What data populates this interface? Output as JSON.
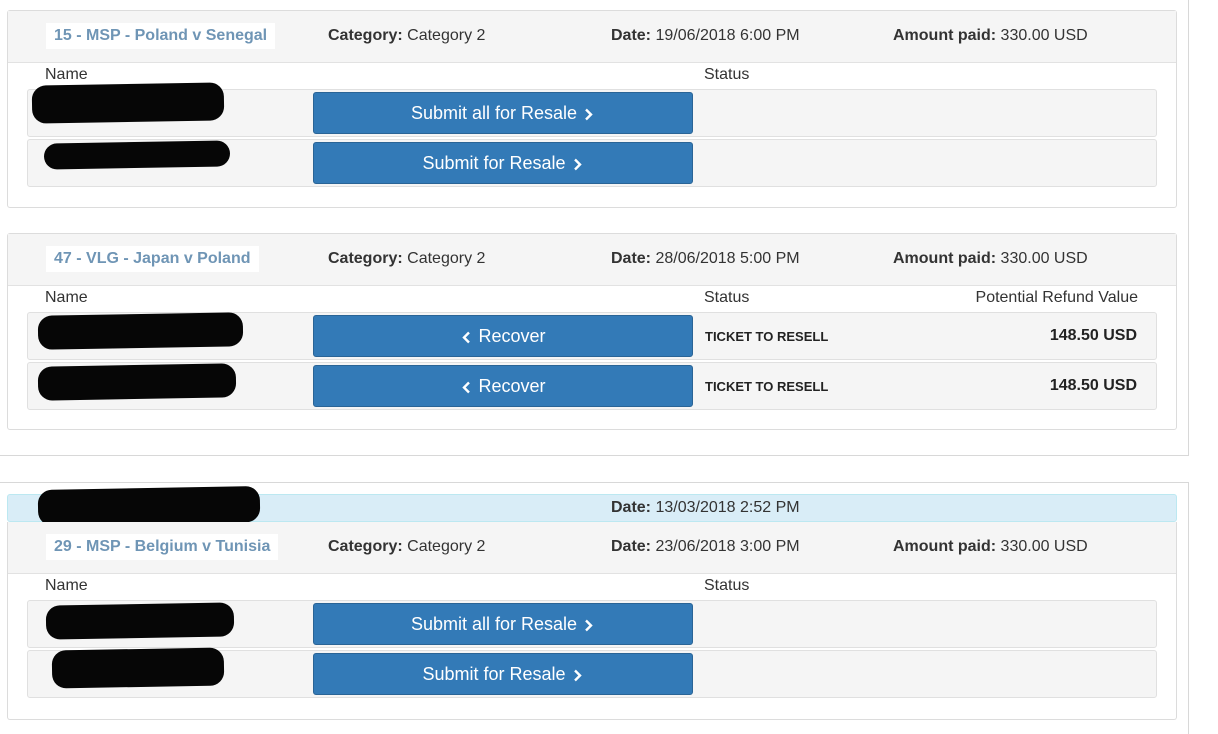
{
  "orders": [
    {
      "matches": [
        {
          "title": "15 - MSP - Poland v Senegal",
          "category_label": "Category:",
          "category_value": "Category 2",
          "date_label": "Date:",
          "date_value": "19/06/2018 6:00 PM",
          "amount_label": "Amount paid:",
          "amount_value": "330.00 USD",
          "col_name": "Name",
          "col_status": "Status",
          "tickets": [
            {
              "button": "Submit all for Resale"
            },
            {
              "button": "Submit for Resale"
            }
          ]
        },
        {
          "title": "47 - VLG - Japan v Poland",
          "category_label": "Category:",
          "category_value": "Category 2",
          "date_label": "Date:",
          "date_value": "28/06/2018 5:00 PM",
          "amount_label": "Amount paid:",
          "amount_value": "330.00 USD",
          "col_name": "Name",
          "col_status": "Status",
          "col_refund": "Potential Refund Value",
          "tickets": [
            {
              "button": "Recover",
              "status": "TICKET TO RESELL",
              "refund": "148.50 USD"
            },
            {
              "button": "Recover",
              "status": "TICKET TO RESELL",
              "refund": "148.50 USD"
            }
          ]
        }
      ]
    },
    {
      "order_date_label": "Date:",
      "order_date_value": "13/03/2018 2:52 PM",
      "matches": [
        {
          "title": "29 - MSP - Belgium v Tunisia",
          "category_label": "Category:",
          "category_value": "Category 2",
          "date_label": "Date:",
          "date_value": "23/06/2018 3:00 PM",
          "amount_label": "Amount paid:",
          "amount_value": "330.00 USD",
          "col_name": "Name",
          "col_status": "Status",
          "tickets": [
            {
              "button": "Submit all for Resale"
            },
            {
              "button": "Submit for Resale"
            }
          ]
        }
      ]
    }
  ],
  "icons": {
    "submit": "chevron-right-icon",
    "recover": "chevron-left-icon"
  },
  "colors": {
    "button": "#337ab7",
    "title": "#6f95b5",
    "order_bar": "#d9edf7"
  }
}
